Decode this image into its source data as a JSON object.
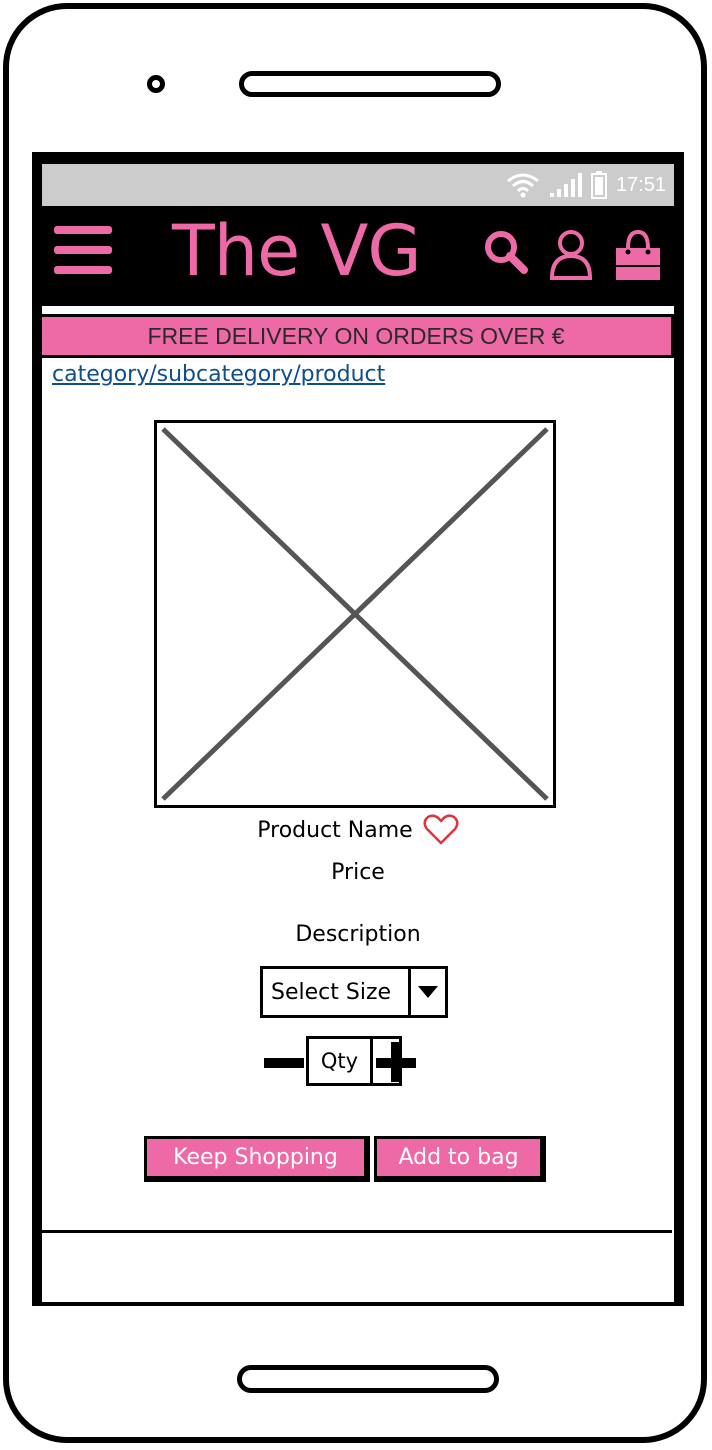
{
  "status_bar": {
    "time": "17:51"
  },
  "header": {
    "logo": "The VG",
    "icons": [
      "menu-icon",
      "search-icon",
      "user-icon",
      "shopping-bag-icon"
    ]
  },
  "promo_banner": "FREE DELIVERY ON ORDERS OVER €",
  "breadcrumb": "category/subcategory/product",
  "product": {
    "name": "Product Name",
    "price": "Price",
    "description": "Description"
  },
  "size_select": {
    "label": "Select Size"
  },
  "quantity": {
    "label": "Qty"
  },
  "actions": {
    "keep_shopping": "Keep Shopping",
    "add_to_bag": "Add to bag"
  },
  "colors": {
    "accent": "#ee6aa7",
    "link": "#0e4f8a",
    "status_bar": "#cccccc",
    "heart": "#d9363e"
  }
}
